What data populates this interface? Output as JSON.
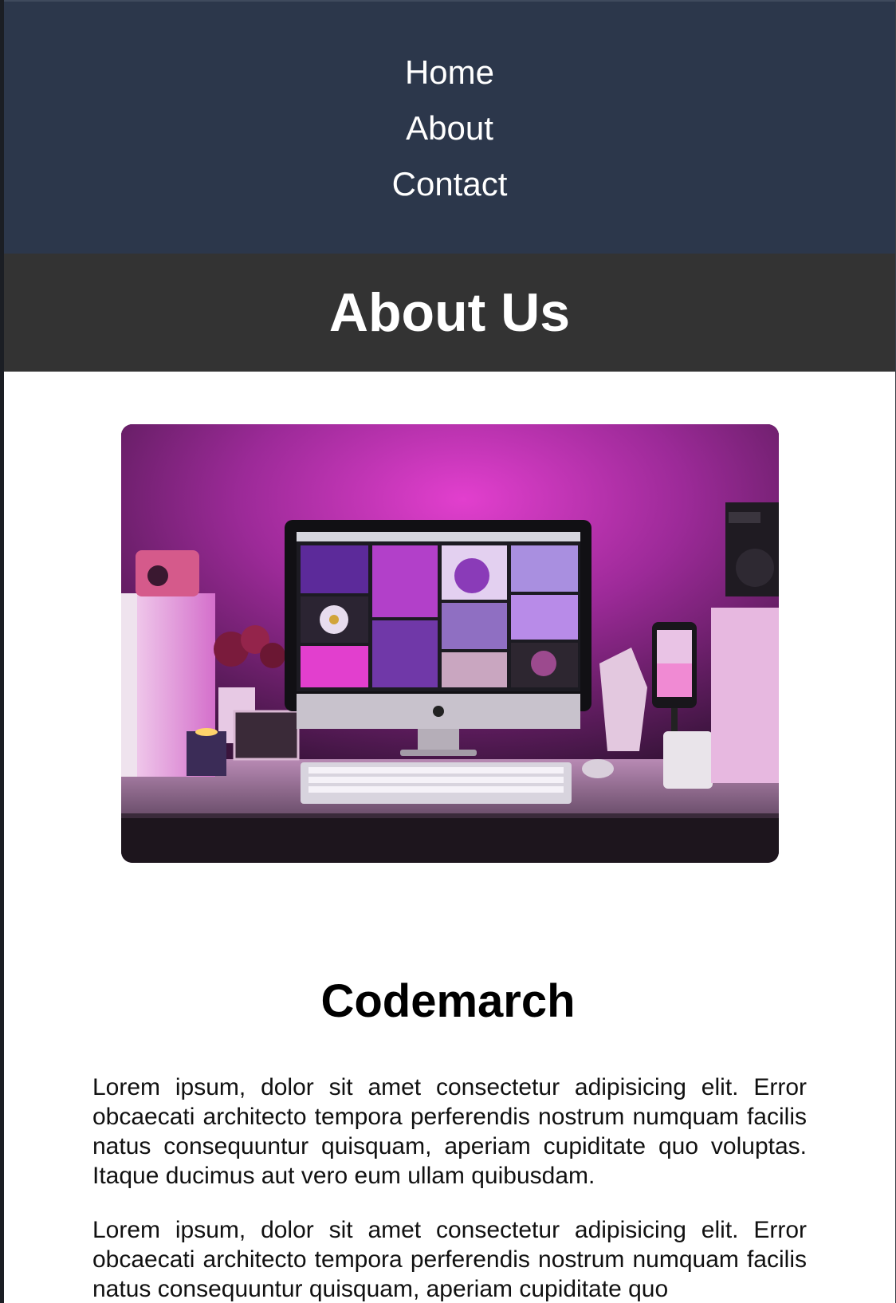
{
  "nav": {
    "items": [
      {
        "label": "Home"
      },
      {
        "label": "About"
      },
      {
        "label": "Contact"
      }
    ]
  },
  "hero": {
    "title": "About Us"
  },
  "photo": {
    "alt": "Desk setup with computer monitor under purple light"
  },
  "content": {
    "title": "Codemarch",
    "paragraphs": [
      "Lorem ipsum, dolor sit amet consectetur adipisicing elit. Error obcaecati architecto tempora perferendis nostrum numquam facilis natus consequuntur quisquam, aperiam cupiditate quo voluptas. Itaque ducimus aut vero eum ullam quibusdam.",
      "Lorem ipsum, dolor sit amet consectetur adipisicing elit. Error obcaecati architecto tempora perferendis nostrum numquam facilis natus consequuntur quisquam, aperiam cupiditate quo"
    ]
  },
  "colors": {
    "nav_bg": "#2c374b",
    "hero_bg": "#333333",
    "text": "#000000",
    "accent": "#e03ad0"
  }
}
